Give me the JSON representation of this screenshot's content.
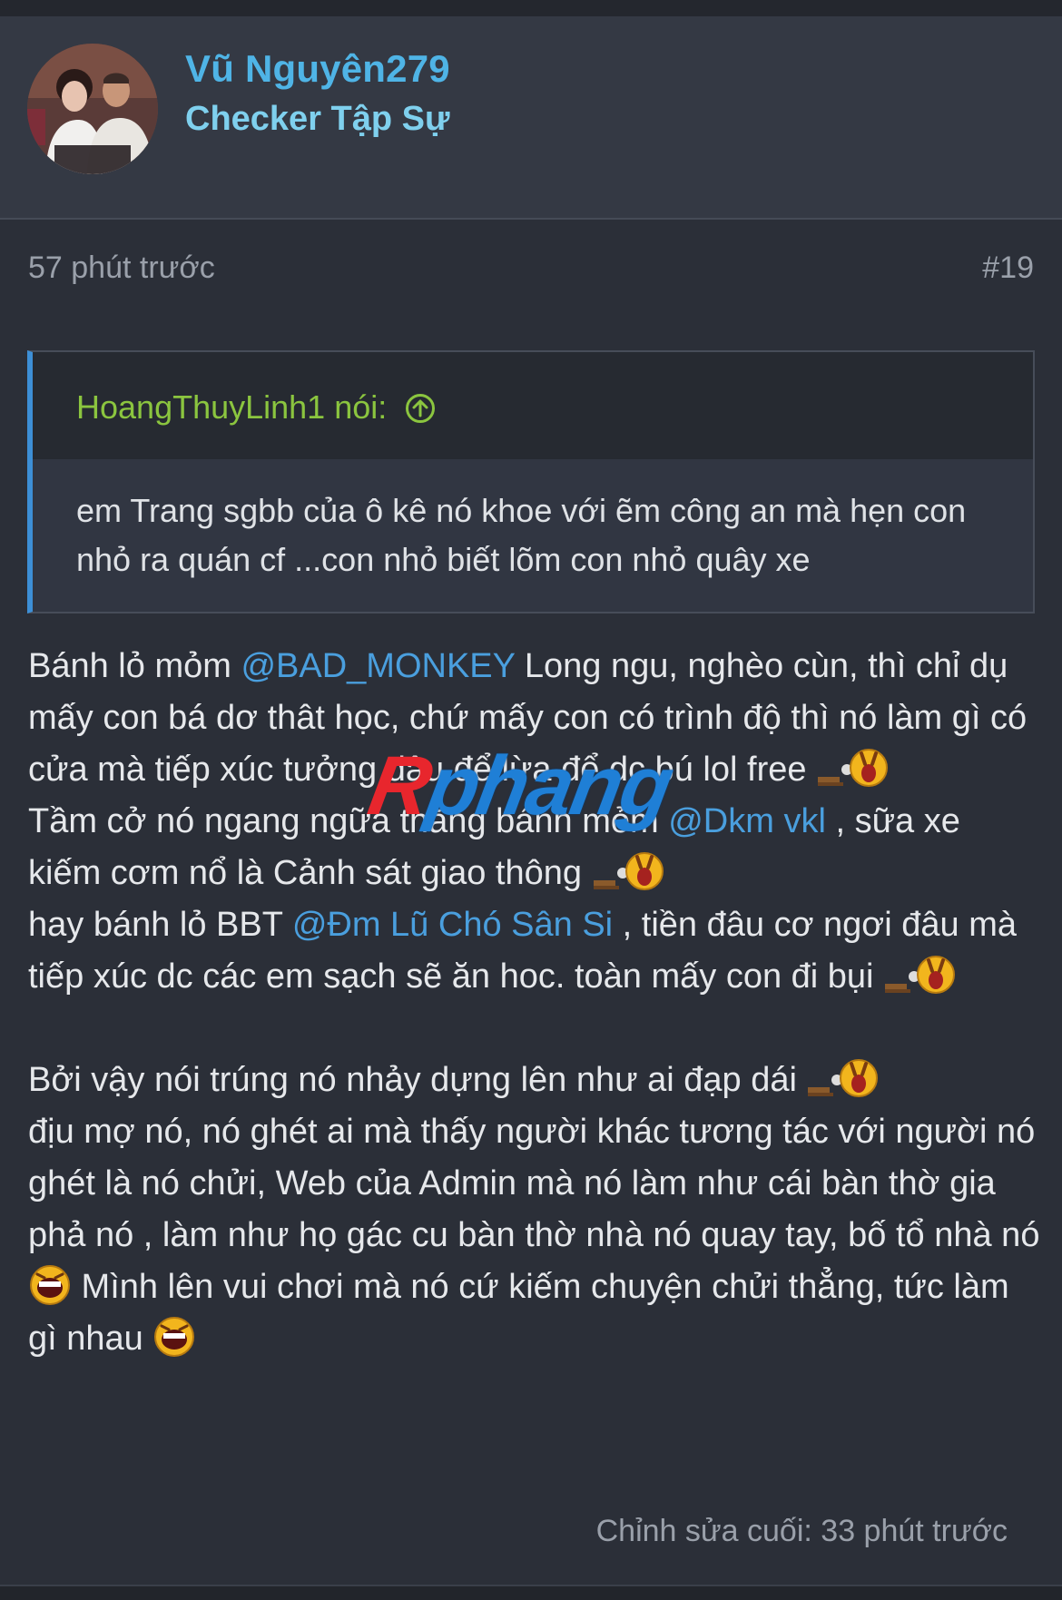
{
  "user": {
    "name": "Vũ Nguyên279",
    "title": "Checker Tập Sự"
  },
  "post": {
    "time": "57 phút trước",
    "number": "#19",
    "edited": "Chỉnh sửa cuối: 33 phút trước"
  },
  "quote": {
    "author": "HoangThuyLinh1 nói:",
    "text": "em Trang sgbb của ô kê nó khoe với ẽm công an mà hẹn con nhỏ ra quán cf ...con nhỏ biết lõm con nhỏ quây xe"
  },
  "body": {
    "p1_a": "Bánh lỏ mỏm ",
    "p1_mention": "@BAD_MONKEY",
    "p1_b": " Long ngu, nghèo cùn, thì chỉ dụ mấy con bá dơ thât học, chứ mấy con có trình độ thì nó làm gì có cửa mà tiếp xúc tưởng đâu để lừa để dc bú lol free ",
    "p2_a": "Tầm cở nó ngang ngữa thằng bánh mỏm ",
    "p2_mention": "@Dkm vkl",
    "p2_b": " , sữa xe kiếm cơm nổ là Cảnh sát giao thông ",
    "p3_a": "hay bánh lỏ BBT ",
    "p3_mention": "@Đm Lũ Chó Sân Si",
    "p3_b": " , tiền đâu cơ ngơi đâu mà tiếp xúc dc các em sạch sẽ ăn hoc. toàn mấy con đi bụi ",
    "p4_a": "Bởi vậy nói trúng nó nhảy dựng lên như ai đạp dái ",
    "p4_b": "địu mợ nó, nó ghét ai mà thấy người khác tương tác với người nó ghét là nó chửi, Web của Admin mà nó làm như cái bàn thờ gia phả nó , làm như họ gác cu bàn thờ nhà nó quay tay, bố tổ nhà nó ",
    "p4_c": " Mình lên vui chơi mà nó cứ kiếm chuyện chửi thẳng, tức làm gì nhau "
  },
  "watermark": {
    "part1": "R",
    "part2": "phang"
  },
  "colors": {
    "background": "#2b2f38",
    "header_bg": "#343944",
    "username": "#4fb4e6",
    "quote_author": "#8bc53f",
    "quote_bar": "#3d8fd6",
    "mention": "#4a9fde"
  },
  "icons": {
    "quote_jump": "arrow-up-circle-icon",
    "emoji_brick": "brick-face-emoji-icon",
    "emoji_scream": "scream-face-emoji-icon"
  }
}
